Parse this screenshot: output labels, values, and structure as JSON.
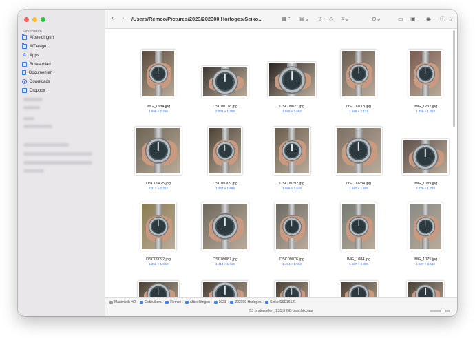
{
  "window": {
    "path": "/Users/Remco/Pictures/2023/202300 Horloges/Seiko..."
  },
  "sidebar": {
    "heading": "Favorieten",
    "items": [
      {
        "label": "Afbeeldingen",
        "icon": "folder-icon"
      },
      {
        "label": "AfDesign",
        "icon": "folder-icon"
      },
      {
        "label": "Apps",
        "icon": "apps-icon"
      },
      {
        "label": "Bureaublad",
        "icon": "desktop-icon"
      },
      {
        "label": "Documenten",
        "icon": "document-icon"
      },
      {
        "label": "Downloads",
        "icon": "download-icon"
      },
      {
        "label": "Dropbox",
        "icon": "box-icon"
      }
    ]
  },
  "files": [
    {
      "name": "IMG_1584.jpg",
      "size": "1.699 × 2.265"
    },
    {
      "name": "DSC00178.jpg",
      "size": "2.034 × 1.358"
    },
    {
      "name": "DSC09827.jpg",
      "size": "3.590 × 2.692"
    },
    {
      "name": "DSC09718.jpg",
      "size": "1.599 × 2.132"
    },
    {
      "name": "IMG_1232.jpg",
      "size": "1.359 × 1.813"
    },
    {
      "name": "DSC09425.jpg",
      "size": "2.312 × 2.312"
    },
    {
      "name": "DSC09309.jpg",
      "size": "1.267 × 1.689"
    },
    {
      "name": "DSC09292.jpg",
      "size": "1.986 × 2.648"
    },
    {
      "name": "DSC09284.jpg",
      "size": "1.597 × 1.505"
    },
    {
      "name": "IMG_1089.jpg",
      "size": "2.379 × 1.783"
    },
    {
      "name": "DSC09092.jpg",
      "size": "1.352 × 1.803"
    },
    {
      "name": "DSC09087.jpg",
      "size": "1.413 × 1.413"
    },
    {
      "name": "DSC09076.jpg",
      "size": "1.494 × 1.993"
    },
    {
      "name": "IMG_1084.jpg",
      "size": "1.567 × 2.090"
    },
    {
      "name": "IMG_1075.jpg",
      "size": "2.607 × 3.610"
    }
  ],
  "pathbar": [
    "Macintosh HD",
    "Gebruikers",
    "Remco",
    "Afbeeldingen",
    "2023",
    "202300 Horloges",
    "Seiko SSE161J1"
  ],
  "status": "53 onderdelen, 235,3 GB beschikbaar",
  "colors": {
    "accent": "#2f7cf6",
    "size_text": "#3d7ad6"
  }
}
